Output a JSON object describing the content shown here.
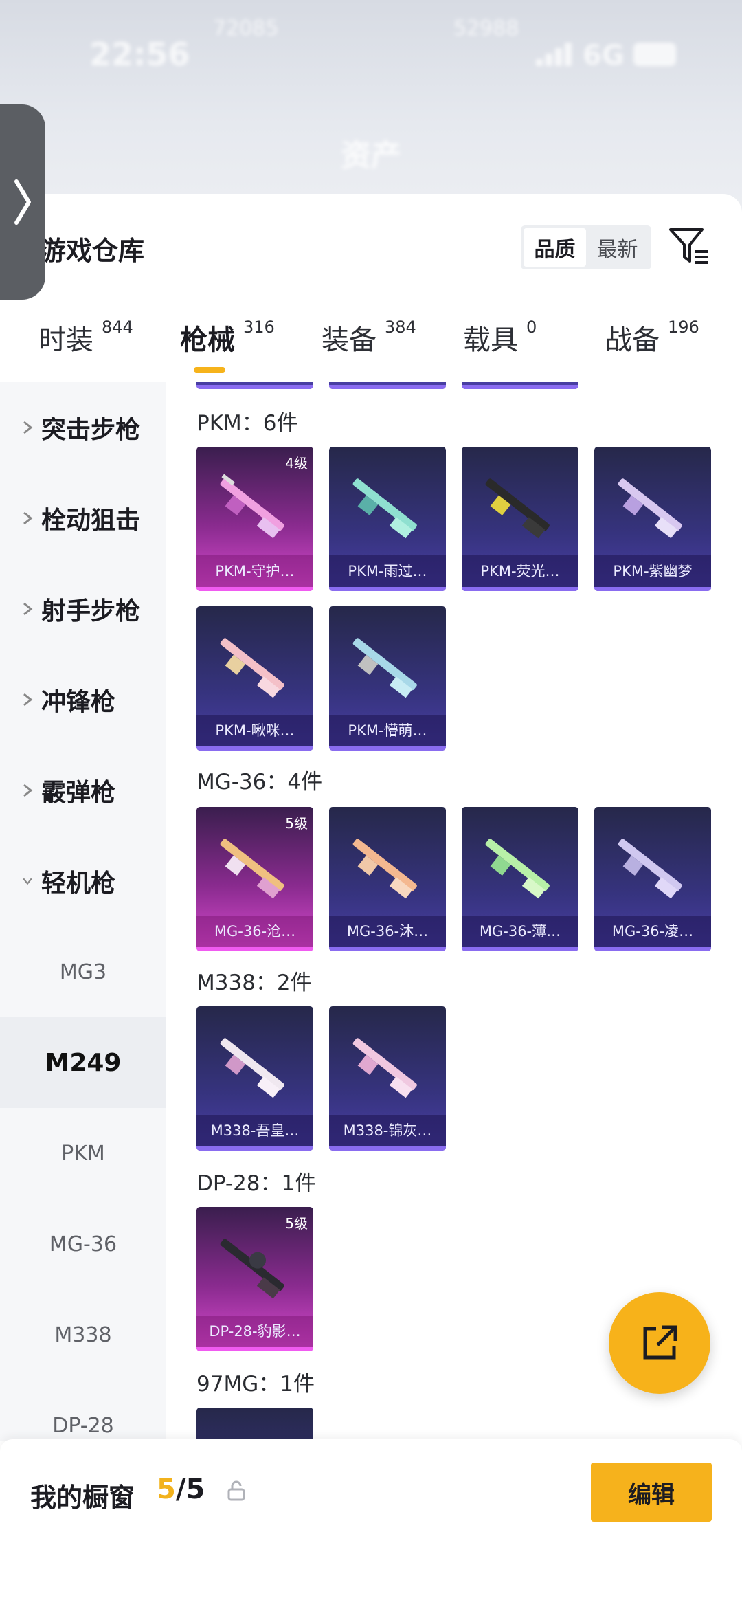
{
  "status_bar": {
    "time": "22:56",
    "carrier": "72085",
    "center": "52988",
    "network": "6G"
  },
  "header": {
    "title": "资产"
  },
  "panel": {
    "title": "游戏仓库",
    "sort": {
      "options": [
        "品质",
        "最新"
      ],
      "selected": "品质"
    },
    "tabs": [
      {
        "label": "时装",
        "count": "844"
      },
      {
        "label": "枪械",
        "count": "316"
      },
      {
        "label": "装备",
        "count": "384"
      },
      {
        "label": "载具",
        "count": "0"
      },
      {
        "label": "战备",
        "count": "196"
      }
    ],
    "active_tab": "枪械"
  },
  "sidebar": {
    "categories": [
      "突击步枪",
      "栓动狙击",
      "射手步枪",
      "冲锋枪",
      "霰弹枪",
      "轻机枪"
    ],
    "subcategories": [
      "MG3",
      "M249",
      "PKM",
      "MG-36",
      "M338",
      "DP-28"
    ],
    "active_subcategory": "M249"
  },
  "sections": [
    {
      "title": "PKM：6件",
      "items": [
        {
          "name": "PKM-守护…",
          "level": "4级",
          "tier": "gold"
        },
        {
          "name": "PKM-雨过…",
          "level": "",
          "tier": "purple"
        },
        {
          "name": "PKM-荧光…",
          "level": "",
          "tier": "purple"
        },
        {
          "name": "PKM-紫幽梦",
          "level": "",
          "tier": "purple"
        },
        {
          "name": "PKM-啾咪…",
          "level": "",
          "tier": "purple"
        },
        {
          "name": "PKM-懵萌…",
          "level": "",
          "tier": "purple"
        }
      ]
    },
    {
      "title": "MG-36：4件",
      "items": [
        {
          "name": "MG-36-沧…",
          "level": "5级",
          "tier": "gold"
        },
        {
          "name": "MG-36-沐…",
          "level": "",
          "tier": "purple"
        },
        {
          "name": "MG-36-薄…",
          "level": "",
          "tier": "purple"
        },
        {
          "name": "MG-36-凌…",
          "level": "",
          "tier": "purple"
        }
      ]
    },
    {
      "title": "M338：2件",
      "items": [
        {
          "name": "M338-吾皇…",
          "level": "",
          "tier": "purple"
        },
        {
          "name": "M338-锦灰…",
          "level": "",
          "tier": "purple"
        }
      ]
    },
    {
      "title": "DP-28：1件",
      "items": [
        {
          "name": "DP-28-豹影…",
          "level": "5级",
          "tier": "gold"
        }
      ]
    },
    {
      "title": "97MG：1件",
      "items": []
    }
  ],
  "bottom": {
    "label": "我的橱窗",
    "current": "5",
    "total": "/5",
    "edit_label": "编辑"
  },
  "colors": {
    "accent": "#f6b21c",
    "purple_card": "#36337e",
    "gold_card": "#c23cc0"
  }
}
